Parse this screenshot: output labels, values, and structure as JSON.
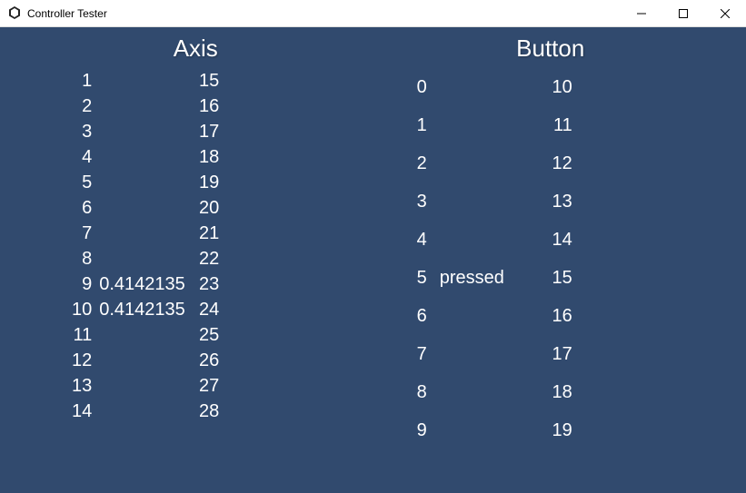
{
  "window": {
    "title": "Controller Tester"
  },
  "axis_section": {
    "header": "Axis",
    "col1": [
      {
        "idx": "1",
        "val": ""
      },
      {
        "idx": "2",
        "val": ""
      },
      {
        "idx": "3",
        "val": ""
      },
      {
        "idx": "4",
        "val": ""
      },
      {
        "idx": "5",
        "val": ""
      },
      {
        "idx": "6",
        "val": ""
      },
      {
        "idx": "7",
        "val": ""
      },
      {
        "idx": "8",
        "val": ""
      },
      {
        "idx": "9",
        "val": "0.4142135"
      },
      {
        "idx": "10",
        "val": "0.4142135"
      },
      {
        "idx": "11",
        "val": ""
      },
      {
        "idx": "12",
        "val": ""
      },
      {
        "idx": "13",
        "val": ""
      },
      {
        "idx": "14",
        "val": ""
      }
    ],
    "col2": [
      {
        "idx": "15",
        "val": ""
      },
      {
        "idx": "16",
        "val": ""
      },
      {
        "idx": "17",
        "val": ""
      },
      {
        "idx": "18",
        "val": ""
      },
      {
        "idx": "19",
        "val": ""
      },
      {
        "idx": "20",
        "val": ""
      },
      {
        "idx": "21",
        "val": ""
      },
      {
        "idx": "22",
        "val": ""
      },
      {
        "idx": "23",
        "val": ""
      },
      {
        "idx": "24",
        "val": ""
      },
      {
        "idx": "25",
        "val": ""
      },
      {
        "idx": "26",
        "val": ""
      },
      {
        "idx": "27",
        "val": ""
      },
      {
        "idx": "28",
        "val": ""
      }
    ]
  },
  "button_section": {
    "header": "Button",
    "col1": [
      {
        "idx": "0",
        "state": ""
      },
      {
        "idx": "1",
        "state": ""
      },
      {
        "idx": "2",
        "state": ""
      },
      {
        "idx": "3",
        "state": ""
      },
      {
        "idx": "4",
        "state": ""
      },
      {
        "idx": "5",
        "state": "pressed"
      },
      {
        "idx": "6",
        "state": ""
      },
      {
        "idx": "7",
        "state": ""
      },
      {
        "idx": "8",
        "state": ""
      },
      {
        "idx": "9",
        "state": ""
      }
    ],
    "col2": [
      {
        "idx": "10",
        "state": ""
      },
      {
        "idx": "11",
        "state": ""
      },
      {
        "idx": "12",
        "state": ""
      },
      {
        "idx": "13",
        "state": ""
      },
      {
        "idx": "14",
        "state": ""
      },
      {
        "idx": "15",
        "state": ""
      },
      {
        "idx": "16",
        "state": ""
      },
      {
        "idx": "17",
        "state": ""
      },
      {
        "idx": "18",
        "state": ""
      },
      {
        "idx": "19",
        "state": ""
      }
    ]
  }
}
